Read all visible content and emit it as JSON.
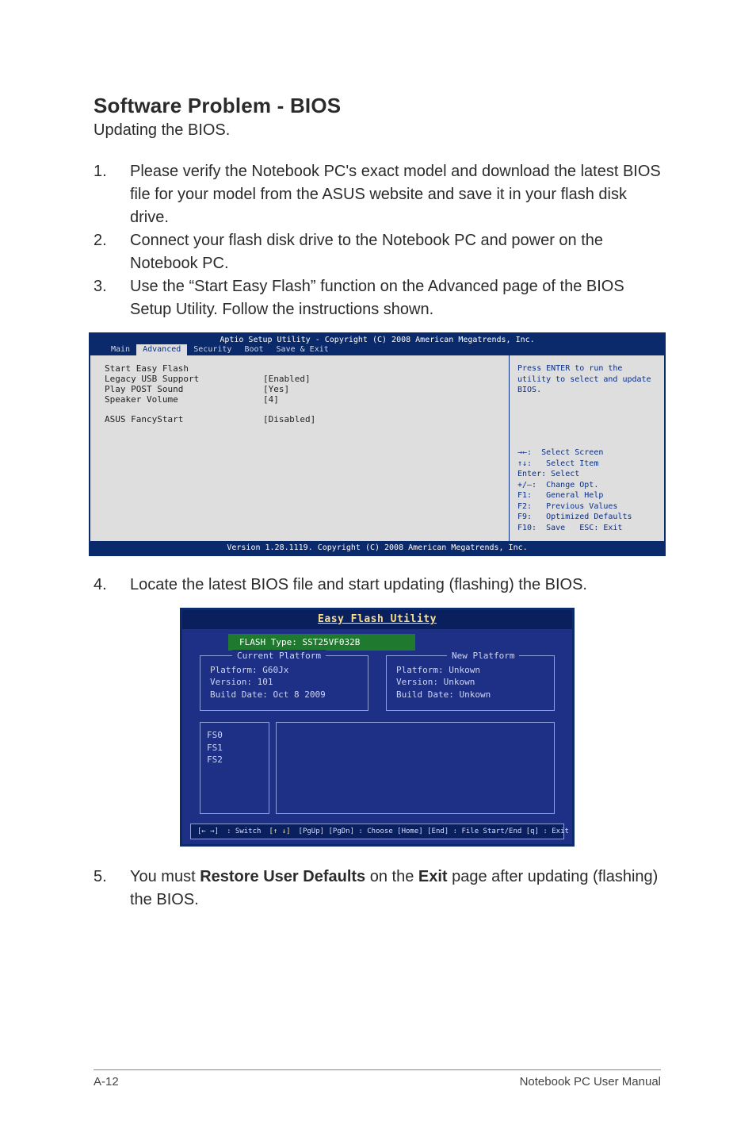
{
  "heading": "Software Problem - BIOS",
  "subtitle": "Updating the BIOS.",
  "steps": {
    "s1": {
      "num": "1.",
      "text": "Please verify the Notebook PC's exact model and download the latest BIOS file for your model from the ASUS website and save it in your flash disk drive."
    },
    "s2": {
      "num": "2.",
      "text": "Connect your flash disk drive to the Notebook PC and power on the Notebook PC."
    },
    "s3": {
      "num": "3.",
      "text": "Use the “Start Easy Flash” function on the Advanced page of the BIOS Setup Utility. Follow the instructions shown."
    },
    "s4": {
      "num": "4.",
      "text": "Locate the latest BIOS file and start updating (flashing) the BIOS."
    },
    "s5_num": "5.",
    "s5_pre": "You must ",
    "s5_b1": "Restore User Defaults",
    "s5_mid": " on the ",
    "s5_b2": "Exit",
    "s5_post": " page after updating (flashing) the BIOS."
  },
  "aptio": {
    "header": "Aptio Setup Utility - Copyright (C) 2008 American Megatrends, Inc.",
    "tabs": {
      "main": "Main",
      "advanced": "Advanced",
      "security": "Security",
      "boot": "Boot",
      "save": "Save & Exit"
    },
    "rows": {
      "r1l": "Start Easy Flash",
      "r1v": "",
      "r2l": "Legacy USB Support",
      "r2v": "[Enabled]",
      "r3l": "Play POST Sound",
      "r3v": "[Yes]",
      "r4l": "Speaker Volume",
      "r4v": "[4]",
      "r5l": "ASUS FancyStart",
      "r5v": "[Disabled]"
    },
    "help": "Press ENTER to run the utility to select and update BIOS.",
    "keys": {
      "k1": "→←:  Select Screen",
      "k2": "↑↓:   Select Item",
      "k3": "Enter: Select",
      "k4": "+/—:  Change Opt.",
      "k5": "F1:   General Help",
      "k6": "F2:   Previous Values",
      "k7": "F9:   Optimized Defaults",
      "k8": "F10:  Save   ESC: Exit"
    },
    "footer": "Version 1.28.1119. Copyright (C) 2008 American Megatrends, Inc."
  },
  "eflash": {
    "title": "Easy Flash Utility",
    "flashtype": "FLASH Type: SST25VF032B",
    "cur": {
      "legend": "Current Platform",
      "platform": "Platform:  G60Jx",
      "version": "Version:   101",
      "build": "Build Date: Oct 8 2009"
    },
    "new": {
      "legend": "New Platform",
      "platform": "Platform:  Unkown",
      "version": "Version:   Unkown",
      "build": "Build Date: Unkown"
    },
    "fs": {
      "a": "FS0",
      "b": "FS1",
      "c": "FS2"
    },
    "foot": {
      "k1": "[← →]",
      "t1": " : Switch   ",
      "k2": "[↑ ↓]",
      "t2": " [PgUp] [PgDn] : Choose   [Home] [End] : File Start/End   [q] : Exit"
    }
  },
  "footer": {
    "left": "A-12",
    "right": "Notebook PC User Manual"
  }
}
